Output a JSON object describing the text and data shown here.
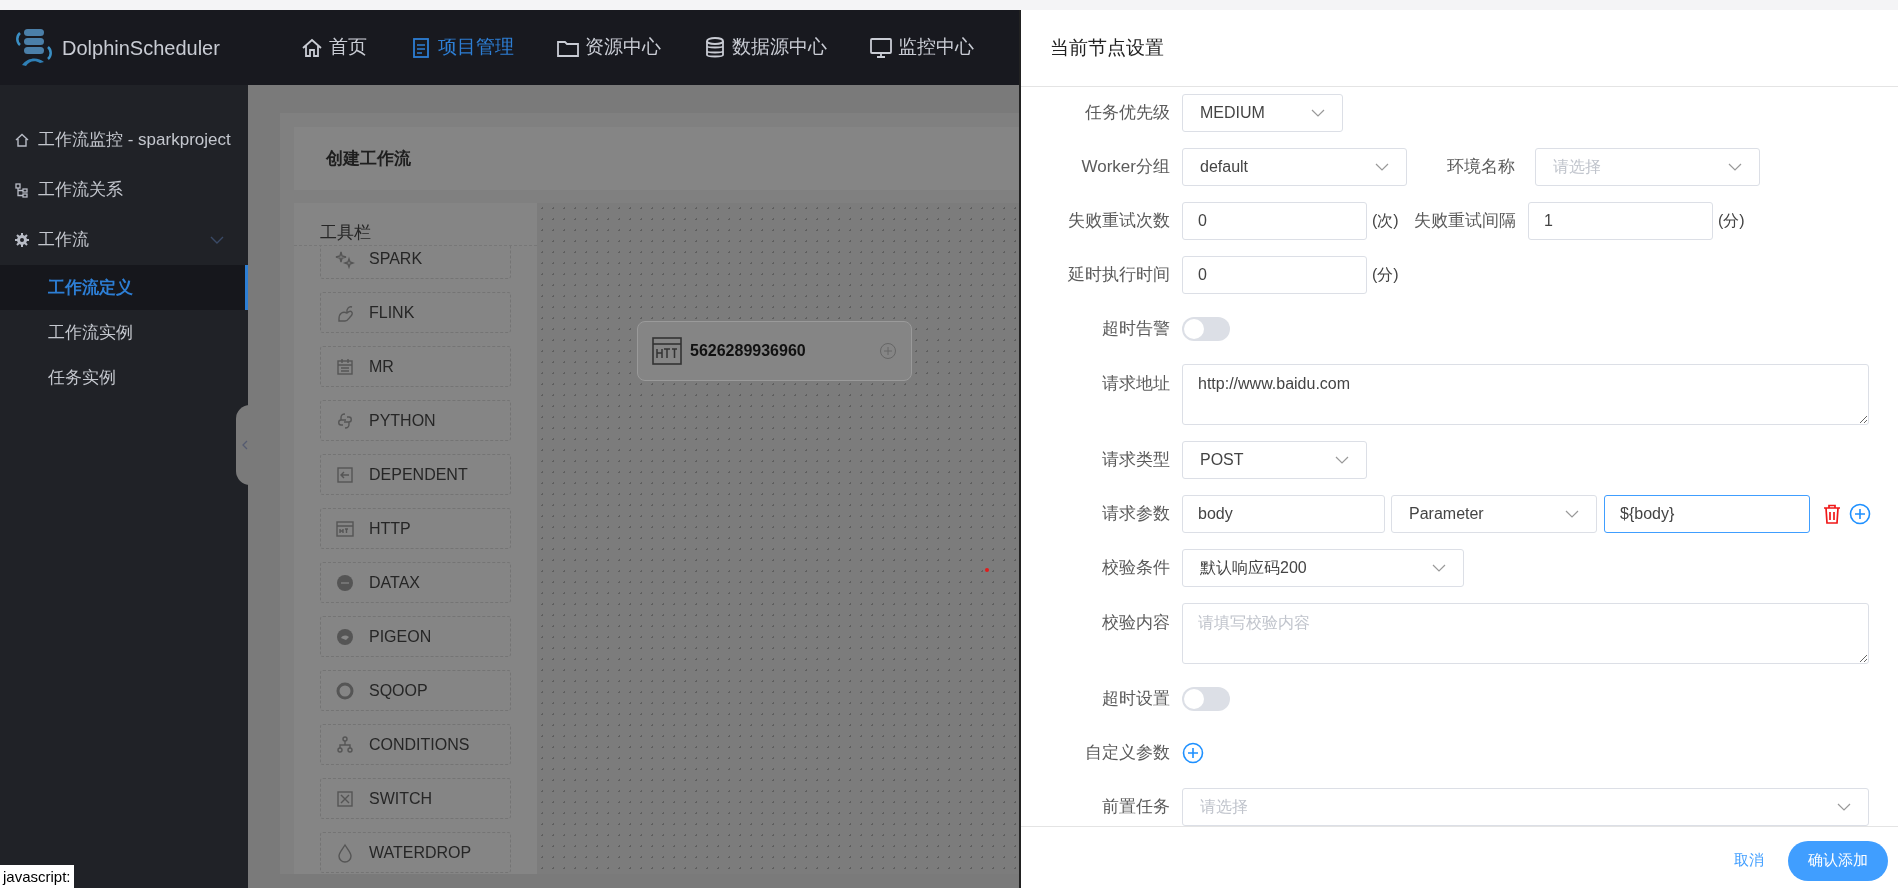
{
  "nav": {
    "brand": "DolphinScheduler",
    "items": [
      {
        "label": "首页",
        "selected": false
      },
      {
        "label": "项目管理",
        "selected": true
      },
      {
        "label": "资源中心",
        "selected": false
      },
      {
        "label": "数据源中心",
        "selected": false
      },
      {
        "label": "监控中心",
        "selected": false
      }
    ]
  },
  "sidebar": {
    "items": [
      {
        "label": "工作流监控 - sparkproject"
      },
      {
        "label": "工作流关系"
      },
      {
        "label": "工作流",
        "expanded": true,
        "children": [
          {
            "label": "工作流定义",
            "selected": true
          },
          {
            "label": "工作流实例",
            "selected": false
          },
          {
            "label": "任务实例",
            "selected": false
          }
        ]
      }
    ]
  },
  "workflow": {
    "title": "创建工作流",
    "toolbar_title": "工具栏",
    "tools": [
      {
        "label": "SPARK"
      },
      {
        "label": "FLINK"
      },
      {
        "label": "MR"
      },
      {
        "label": "PYTHON"
      },
      {
        "label": "DEPENDENT"
      },
      {
        "label": "HTTP"
      },
      {
        "label": "DATAX"
      },
      {
        "label": "PIGEON"
      },
      {
        "label": "SQOOP"
      },
      {
        "label": "CONDITIONS"
      },
      {
        "label": "SWITCH"
      },
      {
        "label": "WATERDROP"
      }
    ],
    "node": {
      "label": "5626289936960"
    }
  },
  "drawer": {
    "title": "当前节点设置",
    "priority": {
      "label": "任务优先级",
      "value": "MEDIUM"
    },
    "worker_group": {
      "label": "Worker分组",
      "value": "default"
    },
    "environment": {
      "label": "环境名称",
      "placeholder": "请选择"
    },
    "retry_times": {
      "label": "失败重试次数",
      "value": "0",
      "unit": "(次)"
    },
    "retry_interval": {
      "label": "失败重试间隔",
      "value": "1",
      "unit": "(分)"
    },
    "delay_time": {
      "label": "延时执行时间",
      "value": "0",
      "unit": "(分)"
    },
    "timeout_alarm": {
      "label": "超时告警",
      "on": false
    },
    "url": {
      "label": "请求地址",
      "value": "http://www.baidu.com"
    },
    "method": {
      "label": "请求类型",
      "value": "POST"
    },
    "params": {
      "label": "请求参数",
      "rows": [
        {
          "name": "body",
          "type": "Parameter",
          "value": "${body}",
          "focused": true
        }
      ]
    },
    "check_condition": {
      "label": "校验条件",
      "value": "默认响应码200"
    },
    "check_content": {
      "label": "校验内容",
      "placeholder": "请填写校验内容"
    },
    "timeout_setting": {
      "label": "超时设置",
      "on": false
    },
    "custom_params": {
      "label": "自定义参数"
    },
    "pre_tasks": {
      "label": "前置任务",
      "placeholder": "请选择"
    },
    "cancel": "取消",
    "confirm": "确认添加"
  },
  "status_tooltip": "javascript:"
}
